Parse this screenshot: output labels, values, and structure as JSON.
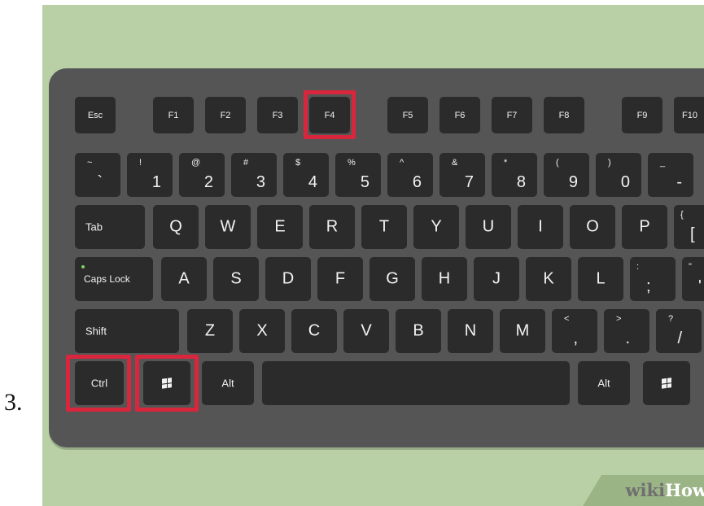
{
  "step": "3.",
  "keys": {
    "esc": "Esc",
    "f1": "F1",
    "f2": "F2",
    "f3": "F3",
    "f4": "F4",
    "f5": "F5",
    "f6": "F6",
    "f7": "F7",
    "f8": "F8",
    "f9": "F9",
    "f10": "F10",
    "backtick": {
      "shift": "~",
      "base": "`"
    },
    "n1": {
      "shift": "!",
      "base": "1"
    },
    "n2": {
      "shift": "@",
      "base": "2"
    },
    "n3": {
      "shift": "#",
      "base": "3"
    },
    "n4": {
      "shift": "$",
      "base": "4"
    },
    "n5": {
      "shift": "%",
      "base": "5"
    },
    "n6": {
      "shift": "^",
      "base": "6"
    },
    "n7": {
      "shift": "&",
      "base": "7"
    },
    "n8": {
      "shift": "*",
      "base": "8"
    },
    "n9": {
      "shift": "(",
      "base": "9"
    },
    "n0": {
      "shift": ")",
      "base": "0"
    },
    "minus": {
      "shift": "_",
      "base": "-"
    },
    "tab": "Tab",
    "q": "Q",
    "w": "W",
    "e": "E",
    "r": "R",
    "t": "T",
    "y": "Y",
    "u": "U",
    "i": "I",
    "o": "O",
    "p": "P",
    "bracket": {
      "shift": "{",
      "base": "["
    },
    "capslock": "Caps Lock",
    "a": "A",
    "s": "S",
    "d": "D",
    "f": "F",
    "g": "G",
    "h": "H",
    "j": "J",
    "k": "K",
    "l": "L",
    "semicolon": {
      "shift": ":",
      "base": ";"
    },
    "quote": {
      "shift": "\"",
      "base": "'"
    },
    "shift": "Shift",
    "z": "Z",
    "x": "X",
    "c": "C",
    "v": "V",
    "b": "B",
    "n": "N",
    "m": "M",
    "comma": {
      "shift": "<",
      "base": ","
    },
    "period": {
      "shift": ">",
      "base": "."
    },
    "slash": {
      "shift": "?",
      "base": "/"
    },
    "ctrl": "Ctrl",
    "alt": "Alt",
    "alt_right": "Alt"
  },
  "win_key_icon": "windows-logo-icon",
  "highlighted_keys": [
    "F4",
    "Ctrl",
    "Windows"
  ],
  "highlight_color": "#d9263c",
  "brand": {
    "part1": "wiki",
    "part2": "How"
  }
}
